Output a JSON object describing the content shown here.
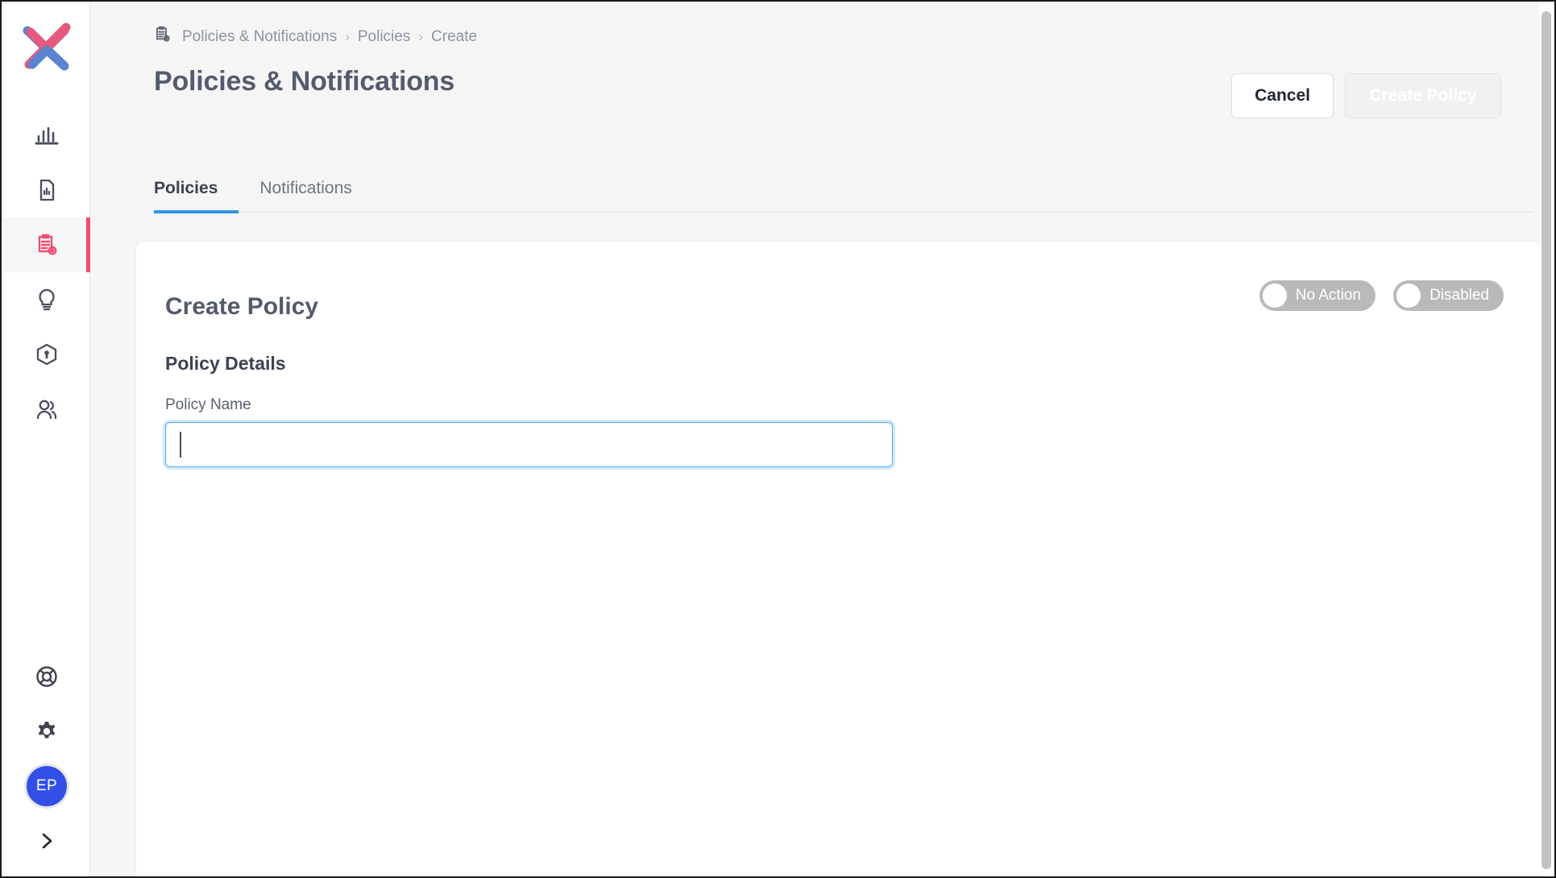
{
  "app": {
    "logo_name": "x-logo"
  },
  "sidebar": {
    "top_items": [
      {
        "icon": "bar-chart-icon",
        "name": "dashboard",
        "active": false
      },
      {
        "icon": "document-chart-icon",
        "name": "reports",
        "active": false
      },
      {
        "icon": "clipboard-gear-icon",
        "name": "policies",
        "active": true
      },
      {
        "icon": "lightbulb-icon",
        "name": "insights",
        "active": false
      },
      {
        "icon": "shield-lock-icon",
        "name": "security",
        "active": false
      },
      {
        "icon": "users-icon",
        "name": "users",
        "active": false
      }
    ],
    "bottom_items": [
      {
        "icon": "lifebuoy-icon",
        "name": "help"
      },
      {
        "icon": "gear-icon",
        "name": "settings"
      }
    ],
    "avatar_initials": "EP",
    "expand_icon": "chevron-right-icon"
  },
  "breadcrumb": {
    "icon": "clipboard-gear-icon",
    "items": [
      "Policies & Notifications",
      "Policies",
      "Create"
    ],
    "separator": "›"
  },
  "header": {
    "title": "Policies & Notifications",
    "cancel_label": "Cancel",
    "create_label": "Create Policy"
  },
  "tabs": [
    {
      "label": "Policies",
      "active": true
    },
    {
      "label": "Notifications",
      "active": false
    }
  ],
  "card": {
    "toggles": [
      {
        "label": "No Action",
        "state": "off"
      },
      {
        "label": "Disabled",
        "state": "off"
      }
    ],
    "title": "Create Policy",
    "section_title": "Policy Details",
    "field_label": "Policy Name",
    "field_value": "",
    "field_placeholder": ""
  },
  "colors": {
    "accent_pink": "#ef4d70",
    "accent_blue": "#2f93e8",
    "avatar_blue": "#3250e8",
    "focus_blue": "#53a9ef",
    "toggle_gray": "#b9b9bb",
    "page_bg": "#f5f5f5"
  }
}
